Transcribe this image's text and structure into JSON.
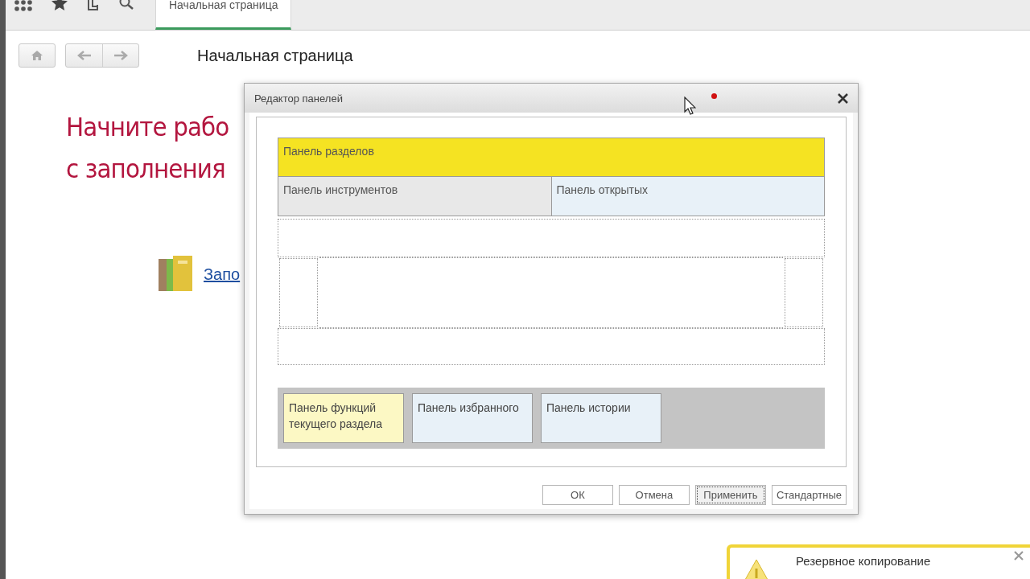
{
  "tabs": [
    {
      "label": "Начальная страница",
      "selected": true
    }
  ],
  "page": {
    "title": "Начальная страница",
    "heading_lines": [
      "Начните рабо",
      "с заполнения"
    ],
    "link": "Запо"
  },
  "dialog": {
    "title": "Редактор панелей",
    "top_panel": {
      "label": "Панель разделов",
      "color": "#f5e322"
    },
    "row_panels": [
      {
        "label": "Панель инструментов",
        "color": "#e8e8e8"
      },
      {
        "label": "Панель открытых",
        "color": "#e8f1f8"
      }
    ],
    "bottom_panels": [
      {
        "label": "Панель функций текущего раздела",
        "color": "#fcf8c4"
      },
      {
        "label": "Панель избранного",
        "color": "#e8f1f8"
      },
      {
        "label": "Панель истории",
        "color": "#e8f1f8"
      }
    ],
    "buttons": [
      {
        "label": "ОК",
        "focused": false
      },
      {
        "label": "Отмена",
        "focused": false
      },
      {
        "label": "Применить",
        "focused": true
      },
      {
        "label": "Стандартные",
        "focused": false
      }
    ]
  },
  "notification": {
    "title": "Резервное копирование"
  }
}
